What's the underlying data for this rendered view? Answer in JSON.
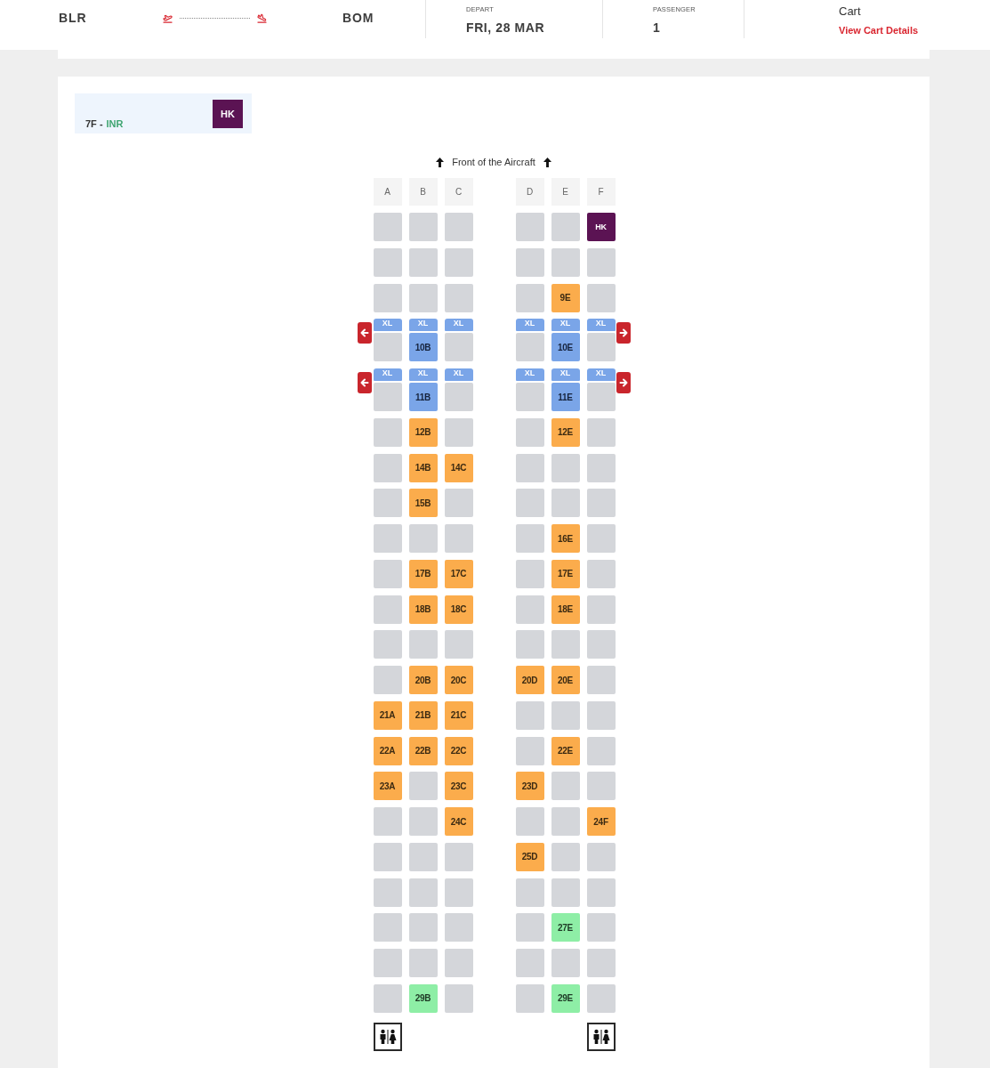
{
  "header": {
    "origin": "BLR",
    "destination": "BOM",
    "depart": {
      "label": "DEPART",
      "value": "FRI, 28 MAR"
    },
    "passenger": {
      "label": "PASSENGER",
      "value": "1"
    },
    "cart": {
      "title": "Cart",
      "link": "View Cart Details"
    }
  },
  "passenger_card": {
    "seat": "7F -",
    "currency": "INR",
    "status": "HK"
  },
  "seat_map": {
    "heading": "Front of the Aircraft",
    "columns": [
      "A",
      "B",
      "C",
      "D",
      "E",
      "F"
    ],
    "rows": [
      {
        "exit": false,
        "seats": [
          {
            "kind": "unavailable"
          },
          {
            "kind": "unavailable"
          },
          {
            "kind": "unavailable"
          },
          {
            "kind": "unavailable"
          },
          {
            "kind": "unavailable"
          },
          {
            "kind": "own",
            "label": "HK"
          }
        ]
      },
      {
        "exit": false,
        "seats": [
          {
            "kind": "unavailable"
          },
          {
            "kind": "unavailable"
          },
          {
            "kind": "unavailable"
          },
          {
            "kind": "unavailable"
          },
          {
            "kind": "unavailable"
          },
          {
            "kind": "unavailable"
          }
        ]
      },
      {
        "exit": false,
        "seats": [
          {
            "kind": "unavailable"
          },
          {
            "kind": "unavailable"
          },
          {
            "kind": "unavailable"
          },
          {
            "kind": "unavailable"
          },
          {
            "kind": "standard",
            "label": "9E"
          },
          {
            "kind": "unavailable"
          }
        ]
      },
      {
        "exit": true,
        "seats": [
          {
            "kind": "unavailable",
            "tag": "XL"
          },
          {
            "kind": "xl",
            "label": "10B",
            "tag": "XL"
          },
          {
            "kind": "unavailable",
            "tag": "XL"
          },
          {
            "kind": "unavailable",
            "tag": "XL"
          },
          {
            "kind": "xl",
            "label": "10E",
            "tag": "XL"
          },
          {
            "kind": "unavailable",
            "tag": "XL"
          }
        ]
      },
      {
        "exit": true,
        "seats": [
          {
            "kind": "unavailable",
            "tag": "XL"
          },
          {
            "kind": "xl",
            "label": "11B",
            "tag": "XL"
          },
          {
            "kind": "unavailable",
            "tag": "XL"
          },
          {
            "kind": "unavailable",
            "tag": "XL"
          },
          {
            "kind": "xl",
            "label": "11E",
            "tag": "XL"
          },
          {
            "kind": "unavailable",
            "tag": "XL"
          }
        ]
      },
      {
        "exit": false,
        "seats": [
          {
            "kind": "unavailable"
          },
          {
            "kind": "standard",
            "label": "12B"
          },
          {
            "kind": "unavailable"
          },
          {
            "kind": "unavailable"
          },
          {
            "kind": "standard",
            "label": "12E"
          },
          {
            "kind": "unavailable"
          }
        ]
      },
      {
        "exit": false,
        "seats": [
          {
            "kind": "unavailable"
          },
          {
            "kind": "standard",
            "label": "14B"
          },
          {
            "kind": "standard",
            "label": "14C"
          },
          {
            "kind": "unavailable"
          },
          {
            "kind": "unavailable"
          },
          {
            "kind": "unavailable"
          }
        ]
      },
      {
        "exit": false,
        "seats": [
          {
            "kind": "unavailable"
          },
          {
            "kind": "standard",
            "label": "15B"
          },
          {
            "kind": "unavailable"
          },
          {
            "kind": "unavailable"
          },
          {
            "kind": "unavailable"
          },
          {
            "kind": "unavailable"
          }
        ]
      },
      {
        "exit": false,
        "seats": [
          {
            "kind": "unavailable"
          },
          {
            "kind": "unavailable"
          },
          {
            "kind": "unavailable"
          },
          {
            "kind": "unavailable"
          },
          {
            "kind": "standard",
            "label": "16E"
          },
          {
            "kind": "unavailable"
          }
        ]
      },
      {
        "exit": false,
        "seats": [
          {
            "kind": "unavailable"
          },
          {
            "kind": "standard",
            "label": "17B"
          },
          {
            "kind": "standard",
            "label": "17C"
          },
          {
            "kind": "unavailable"
          },
          {
            "kind": "standard",
            "label": "17E"
          },
          {
            "kind": "unavailable"
          }
        ]
      },
      {
        "exit": false,
        "seats": [
          {
            "kind": "unavailable"
          },
          {
            "kind": "standard",
            "label": "18B"
          },
          {
            "kind": "standard",
            "label": "18C"
          },
          {
            "kind": "unavailable"
          },
          {
            "kind": "standard",
            "label": "18E"
          },
          {
            "kind": "unavailable"
          }
        ]
      },
      {
        "exit": false,
        "seats": [
          {
            "kind": "unavailable"
          },
          {
            "kind": "unavailable"
          },
          {
            "kind": "unavailable"
          },
          {
            "kind": "unavailable"
          },
          {
            "kind": "unavailable"
          },
          {
            "kind": "unavailable"
          }
        ]
      },
      {
        "exit": false,
        "seats": [
          {
            "kind": "unavailable"
          },
          {
            "kind": "standard",
            "label": "20B"
          },
          {
            "kind": "standard",
            "label": "20C"
          },
          {
            "kind": "standard",
            "label": "20D"
          },
          {
            "kind": "standard",
            "label": "20E"
          },
          {
            "kind": "unavailable"
          }
        ]
      },
      {
        "exit": false,
        "seats": [
          {
            "kind": "standard",
            "label": "21A"
          },
          {
            "kind": "standard",
            "label": "21B"
          },
          {
            "kind": "standard",
            "label": "21C"
          },
          {
            "kind": "unavailable"
          },
          {
            "kind": "unavailable"
          },
          {
            "kind": "unavailable"
          }
        ]
      },
      {
        "exit": false,
        "seats": [
          {
            "kind": "standard",
            "label": "22A"
          },
          {
            "kind": "standard",
            "label": "22B"
          },
          {
            "kind": "standard",
            "label": "22C"
          },
          {
            "kind": "unavailable"
          },
          {
            "kind": "standard",
            "label": "22E"
          },
          {
            "kind": "unavailable"
          }
        ]
      },
      {
        "exit": false,
        "seats": [
          {
            "kind": "standard",
            "label": "23A"
          },
          {
            "kind": "unavailable"
          },
          {
            "kind": "standard",
            "label": "23C"
          },
          {
            "kind": "standard",
            "label": "23D"
          },
          {
            "kind": "unavailable"
          },
          {
            "kind": "unavailable"
          }
        ]
      },
      {
        "exit": false,
        "seats": [
          {
            "kind": "unavailable"
          },
          {
            "kind": "unavailable"
          },
          {
            "kind": "standard",
            "label": "24C"
          },
          {
            "kind": "unavailable"
          },
          {
            "kind": "unavailable"
          },
          {
            "kind": "standard",
            "label": "24F"
          }
        ]
      },
      {
        "exit": false,
        "seats": [
          {
            "kind": "unavailable"
          },
          {
            "kind": "unavailable"
          },
          {
            "kind": "unavailable"
          },
          {
            "kind": "standard",
            "label": "25D"
          },
          {
            "kind": "unavailable"
          },
          {
            "kind": "unavailable"
          }
        ]
      },
      {
        "exit": false,
        "seats": [
          {
            "kind": "unavailable"
          },
          {
            "kind": "unavailable"
          },
          {
            "kind": "unavailable"
          },
          {
            "kind": "unavailable"
          },
          {
            "kind": "unavailable"
          },
          {
            "kind": "unavailable"
          }
        ]
      },
      {
        "exit": false,
        "seats": [
          {
            "kind": "unavailable"
          },
          {
            "kind": "unavailable"
          },
          {
            "kind": "unavailable"
          },
          {
            "kind": "unavailable"
          },
          {
            "kind": "free",
            "label": "27E"
          },
          {
            "kind": "unavailable"
          }
        ]
      },
      {
        "exit": false,
        "seats": [
          {
            "kind": "unavailable"
          },
          {
            "kind": "unavailable"
          },
          {
            "kind": "unavailable"
          },
          {
            "kind": "unavailable"
          },
          {
            "kind": "unavailable"
          },
          {
            "kind": "unavailable"
          }
        ]
      },
      {
        "exit": false,
        "seats": [
          {
            "kind": "unavailable"
          },
          {
            "kind": "free",
            "label": "29B"
          },
          {
            "kind": "unavailable"
          },
          {
            "kind": "unavailable"
          },
          {
            "kind": "free",
            "label": "29E"
          },
          {
            "kind": "unavailable"
          }
        ]
      }
    ]
  }
}
